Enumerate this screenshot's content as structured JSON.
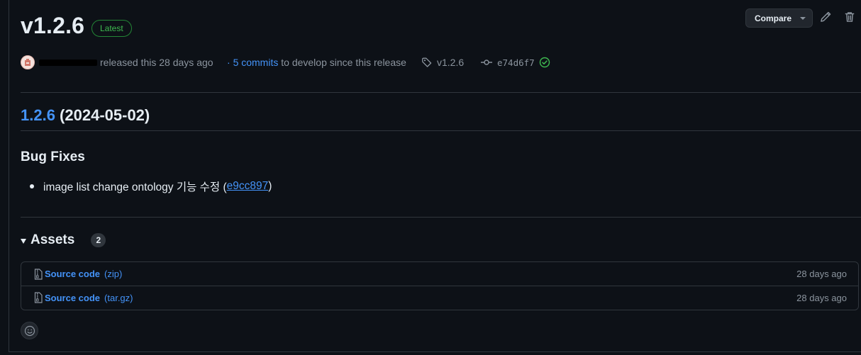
{
  "release": {
    "title": "v1.2.6",
    "badge": "Latest",
    "released_text": "released this 28 days ago",
    "commits_prefix": "· ",
    "commits_link": "5 commits",
    "commits_suffix": " to develop since this release",
    "tag": "v1.2.6",
    "commit_sha": "e74d6f7"
  },
  "toolbar": {
    "compare_label": "Compare"
  },
  "notes": {
    "version_link": "1.2.6",
    "version_date": " (2024-05-02)",
    "section_title": "Bug Fixes",
    "items": [
      {
        "text": "image list change ontology 기능 수정 (",
        "commit": "e9cc897",
        "close": ")"
      }
    ]
  },
  "assets": {
    "title": "Assets",
    "count": "2",
    "items": [
      {
        "name": "Source code",
        "format": "(zip)",
        "date": "28 days ago"
      },
      {
        "name": "Source code",
        "format": "(tar.gz)",
        "date": "28 days ago"
      }
    ]
  },
  "colors": {
    "background": "#0d1117",
    "link": "#4493f8",
    "badge_green": "#3fb950",
    "muted": "#8b949e",
    "border": "#30363d"
  }
}
